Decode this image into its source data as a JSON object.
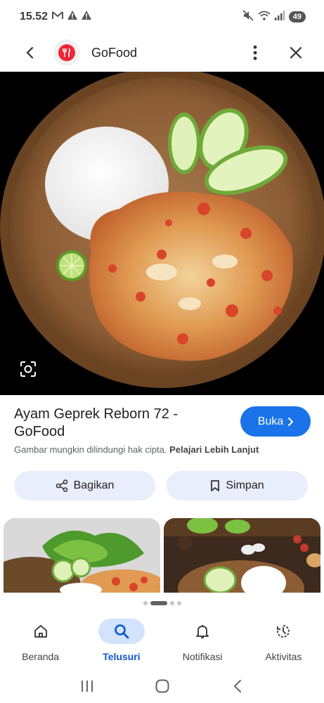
{
  "status_bar": {
    "time": "15.52",
    "battery": "49"
  },
  "header": {
    "site_name": "GoFood"
  },
  "result": {
    "title": "Ayam Geprek Reborn 72 - GoFood",
    "open_label": "Buka",
    "notice": "Gambar mungkin dilindungi hak cipta.",
    "notice_link": "Pelajari Lebih Lanjut"
  },
  "actions": {
    "share_label": "Bagikan",
    "save_label": "Simpan"
  },
  "pager": {
    "total": 4,
    "active": 1
  },
  "bottom_nav": {
    "items": [
      {
        "label": "Beranda",
        "icon": "home-icon",
        "active": false
      },
      {
        "label": "Telusuri",
        "icon": "search-icon",
        "active": true
      },
      {
        "label": "Notifikasi",
        "icon": "bell-icon",
        "active": false
      },
      {
        "label": "Aktivitas",
        "icon": "activity-icon",
        "active": false
      }
    ]
  },
  "colors": {
    "accent": "#1a73e8",
    "chip_bg": "#e8eefb",
    "nav_active_bg": "#d3e3fd",
    "brand_red": "#ee2737"
  }
}
